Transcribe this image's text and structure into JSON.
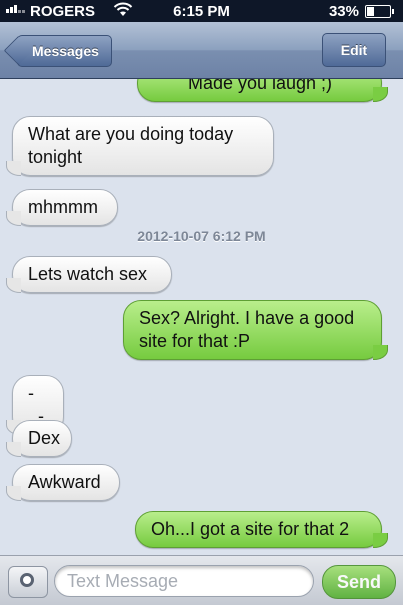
{
  "status_bar": {
    "carrier": "ROGERS",
    "time": "6:15 PM",
    "battery_percent": "33%"
  },
  "nav": {
    "back_label": "Messages",
    "edit_label": "Edit"
  },
  "messages": [
    {
      "direction": "sent",
      "text": "Made you laugh ;)"
    },
    {
      "direction": "received",
      "text": "What are you doing today tonight"
    },
    {
      "direction": "received",
      "text": "mhmmm"
    },
    {
      "direction": "received",
      "text": "Lets watch sex"
    },
    {
      "direction": "sent",
      "text": "Sex? Alright. I have a good site for that :P"
    },
    {
      "direction": "received",
      "text": "-_-"
    },
    {
      "direction": "received",
      "text": "Dex"
    },
    {
      "direction": "received",
      "text": "Awkward"
    },
    {
      "direction": "sent",
      "text": "Oh...I got a site for that 2"
    }
  ],
  "timestamp": "2012-10-07 6:12 PM",
  "input": {
    "placeholder": "Text Message",
    "send_label": "Send"
  },
  "icons": {
    "wifi": "wifi-icon",
    "camera": "camera-icon",
    "back": "chevron-left-icon"
  },
  "colors": {
    "sent_bubble": "#84d24c",
    "received_bubble": "#efefef",
    "thread_background": "#dbe2ed",
    "nav_bar": "#7a8fb0"
  }
}
